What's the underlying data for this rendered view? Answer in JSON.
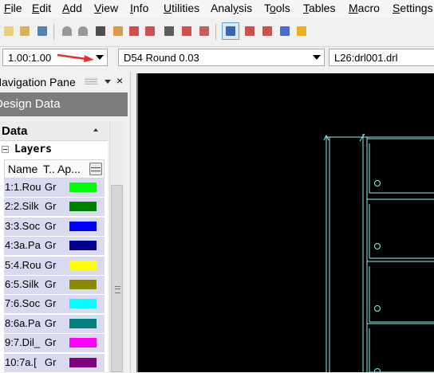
{
  "menu": [
    {
      "pre": "",
      "ul": "F",
      "post": "ile"
    },
    {
      "pre": "",
      "ul": "E",
      "post": "dit"
    },
    {
      "pre": "",
      "ul": "A",
      "post": "dd"
    },
    {
      "pre": "",
      "ul": "V",
      "post": "iew"
    },
    {
      "pre": "",
      "ul": "I",
      "post": "nfo"
    },
    {
      "pre": "",
      "ul": "U",
      "post": "tilities"
    },
    {
      "pre": "Anal",
      "ul": "y",
      "post": "sis"
    },
    {
      "pre": "T",
      "ul": "o",
      "post": "ols"
    },
    {
      "pre": "",
      "ul": "T",
      "post": "ables"
    },
    {
      "pre": "",
      "ul": "M",
      "post": "acro"
    },
    {
      "pre": "",
      "ul": "S",
      "post": "ettings"
    }
  ],
  "toolbar_icons": [
    "new-icon",
    "open-icon",
    "save-icon",
    "arc-icon",
    "arc2-icon",
    "zoom-extents-icon",
    "import-icon",
    "zoom-in-icon",
    "zoom-out-icon",
    "zoom-window-icon",
    "drc-icon",
    "panel-icon",
    "select-icon",
    "grid-icon",
    "grid2-icon",
    "layer-colors-icon",
    "highlight-icon"
  ],
  "combos": {
    "scale": "1.00:1.00",
    "dcode": "D54  Round 0.03",
    "layer": "L26:drl001.drl"
  },
  "nav": {
    "title": "Navigation Pane",
    "close": "×",
    "design_data": "Design Data",
    "data_label": "Data",
    "layers_label": "Layers",
    "col_name": "Name",
    "col_type": "T..",
    "col_appearance": "Ap..."
  },
  "layers": [
    {
      "name": "1:1.Rou",
      "type": "Gr",
      "color": "#00ff00"
    },
    {
      "name": "2:2.Silk",
      "type": "Gr",
      "color": "#008000"
    },
    {
      "name": "3:3.Soc",
      "type": "Gr",
      "color": "#0000ff"
    },
    {
      "name": "4:3a.Pa",
      "type": "Gr",
      "color": "#000090"
    },
    {
      "name": "5:4.Rou",
      "type": "Gr",
      "color": "#ffff00"
    },
    {
      "name": "6:5.Silk",
      "type": "Gr",
      "color": "#8a8a00"
    },
    {
      "name": "7:6.Soc",
      "type": "Gr",
      "color": "#00ffff"
    },
    {
      "name": "8:6a.Pa",
      "type": "Gr",
      "color": "#008080"
    },
    {
      "name": "9:7.Dil_",
      "type": "Gr",
      "color": "#ff00ff"
    },
    {
      "name": "10:7a.[",
      "type": "Gr",
      "color": "#800080"
    }
  ],
  "canvas": {
    "background": "#000000",
    "line_color": "#8ff0ea"
  }
}
